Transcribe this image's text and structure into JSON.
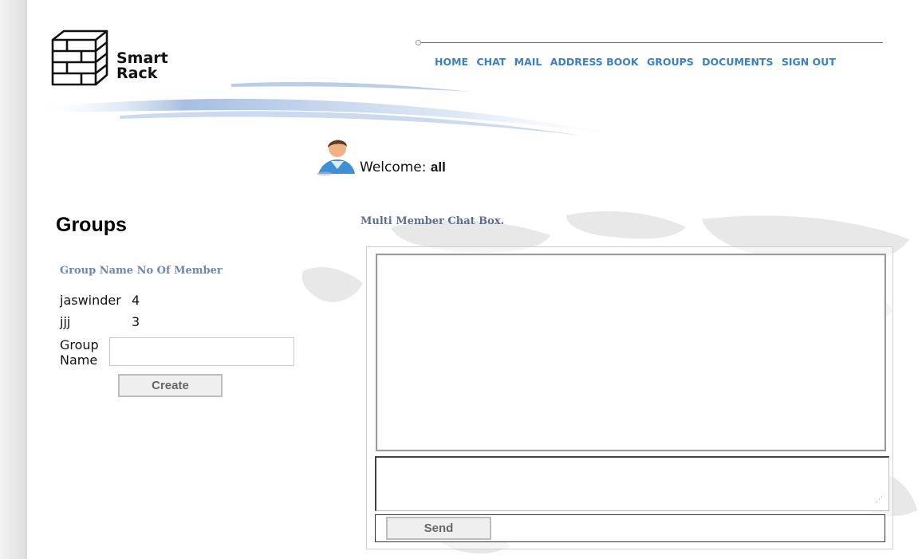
{
  "logo": {
    "line1": "Smart",
    "line2": "Rack"
  },
  "nav": [
    {
      "label": "HOME"
    },
    {
      "label": "CHAT"
    },
    {
      "label": "MAIL"
    },
    {
      "label": "ADDRESS BOOK"
    },
    {
      "label": "GROUPS"
    },
    {
      "label": "DOCUMENTS"
    },
    {
      "label": "SIGN OUT"
    }
  ],
  "welcome": {
    "label": "Welcome:",
    "user": "all"
  },
  "groups": {
    "title": "Groups",
    "col_name": "Group Name",
    "col_members": "No Of Member",
    "rows": [
      {
        "name": "jaswinder",
        "count": "4"
      },
      {
        "name": "jjj",
        "count": "3"
      }
    ],
    "form_label_line1": "Group",
    "form_label_line2": "Name",
    "form_value": "",
    "create_label": "Create"
  },
  "chat": {
    "title": "Multi Member Chat Box.",
    "log": "",
    "input_value": "",
    "send_label": "Send"
  },
  "colors": {
    "nav": "#3d80c0",
    "section_heading": "#6f86ad",
    "chat_title": "#5c6e90"
  },
  "icons": [
    "logo-rack-icon",
    "user-avatar-icon",
    "resize-grip-icon"
  ]
}
